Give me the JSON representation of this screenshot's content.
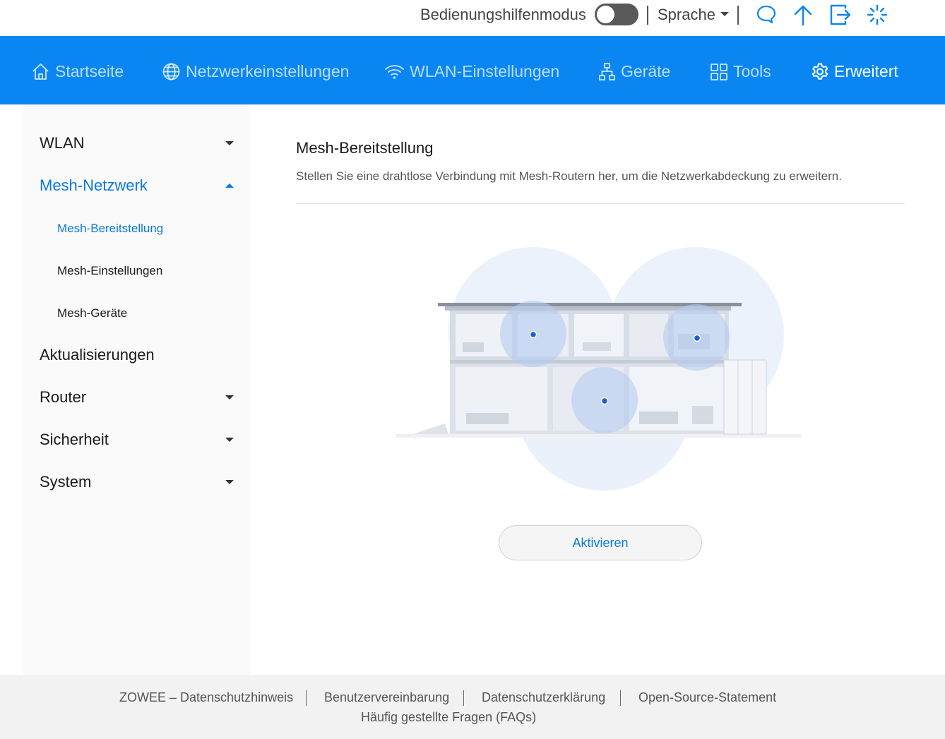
{
  "topbar": {
    "accessibility_label": "Bedienungshilfenmodus",
    "accessibility_enabled": false,
    "language_label": "Sprache",
    "icons": [
      "chat-icon",
      "upload-icon",
      "logout-icon",
      "loading-icon"
    ]
  },
  "nav": {
    "items": [
      {
        "label": "Startseite",
        "icon": "home-icon",
        "active": false
      },
      {
        "label": "Netzwerkeinstellungen",
        "icon": "globe-icon",
        "active": false
      },
      {
        "label": "WLAN-Einstellungen",
        "icon": "wifi-icon",
        "active": false
      },
      {
        "label": "Geräte",
        "icon": "network-devices-icon",
        "active": false
      },
      {
        "label": "Tools",
        "icon": "tools-grid-icon",
        "active": false
      },
      {
        "label": "Erweitert",
        "icon": "gear-icon",
        "active": true
      }
    ]
  },
  "sidebar": {
    "items": [
      {
        "label": "WLAN",
        "expanded": false
      },
      {
        "label": "Mesh-Netzwerk",
        "expanded": true
      },
      {
        "label": "Aktualisierungen"
      },
      {
        "label": "Router",
        "expanded": false
      },
      {
        "label": "Sicherheit",
        "expanded": false
      },
      {
        "label": "System",
        "expanded": false
      }
    ],
    "mesh_subitems": [
      {
        "label": "Mesh-Bereitstellung",
        "active": true
      },
      {
        "label": "Mesh-Einstellungen",
        "active": false
      },
      {
        "label": "Mesh-Geräte",
        "active": false
      }
    ]
  },
  "main": {
    "title": "Mesh-Bereitstellung",
    "description": "Stellen Sie eine drahtlose Verbindung mit Mesh-Routern her, um die Netzwerkabdeckung zu erweitern.",
    "activate_button": "Aktivieren"
  },
  "footer": {
    "links": [
      "ZOWEE – Datenschutzhinweis",
      "Benutzervereinbarung",
      "Datenschutzerklärung",
      "Open-Source-Statement"
    ],
    "faq": "Häufig gestellte Fragen (FAQs)"
  },
  "colors": {
    "accent": "#0a86f2",
    "link": "#0a79de",
    "footer_bg": "#f2f2f2",
    "sidebar_bg": "#fafafa"
  }
}
